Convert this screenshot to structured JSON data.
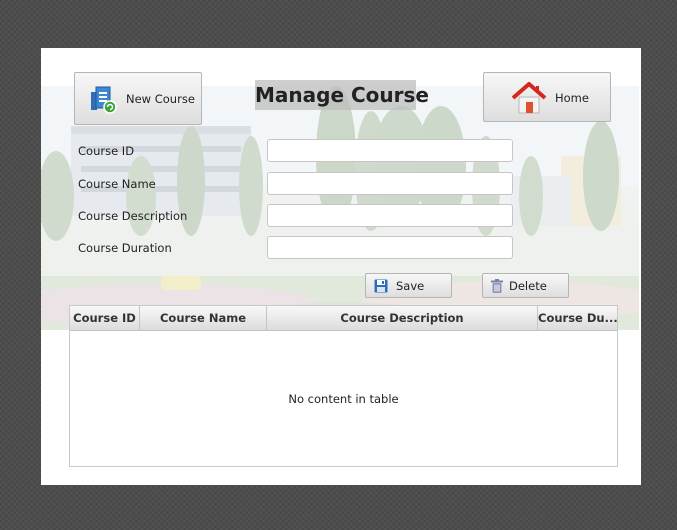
{
  "window": {
    "title": "Manage Course"
  },
  "toolbar": {
    "new_course_label": "New Course",
    "home_label": "Home"
  },
  "form": {
    "fields": [
      {
        "label": "Course ID",
        "value": "",
        "placeholder": ""
      },
      {
        "label": "Course Name",
        "value": "",
        "placeholder": ""
      },
      {
        "label": "Course Description",
        "value": "",
        "placeholder": ""
      },
      {
        "label": "Course Duration",
        "value": "",
        "placeholder": ""
      }
    ],
    "save_label": "Save",
    "delete_label": "Delete"
  },
  "table": {
    "columns": [
      "Course ID",
      "Course Name",
      "Course Description",
      "Course Du..."
    ],
    "rows": [],
    "empty_message": "No content in table"
  },
  "icons": {
    "new_course": "new-document-icon",
    "home": "house-icon",
    "save": "floppy-disk-icon",
    "delete": "trash-can-icon"
  },
  "colors": {
    "desktop_bg": "#4d4d4d",
    "window_bg": "#ffffff",
    "title_highlight": "#bebebe",
    "button_top": "#f7f7f7",
    "button_bottom": "#dedede"
  }
}
